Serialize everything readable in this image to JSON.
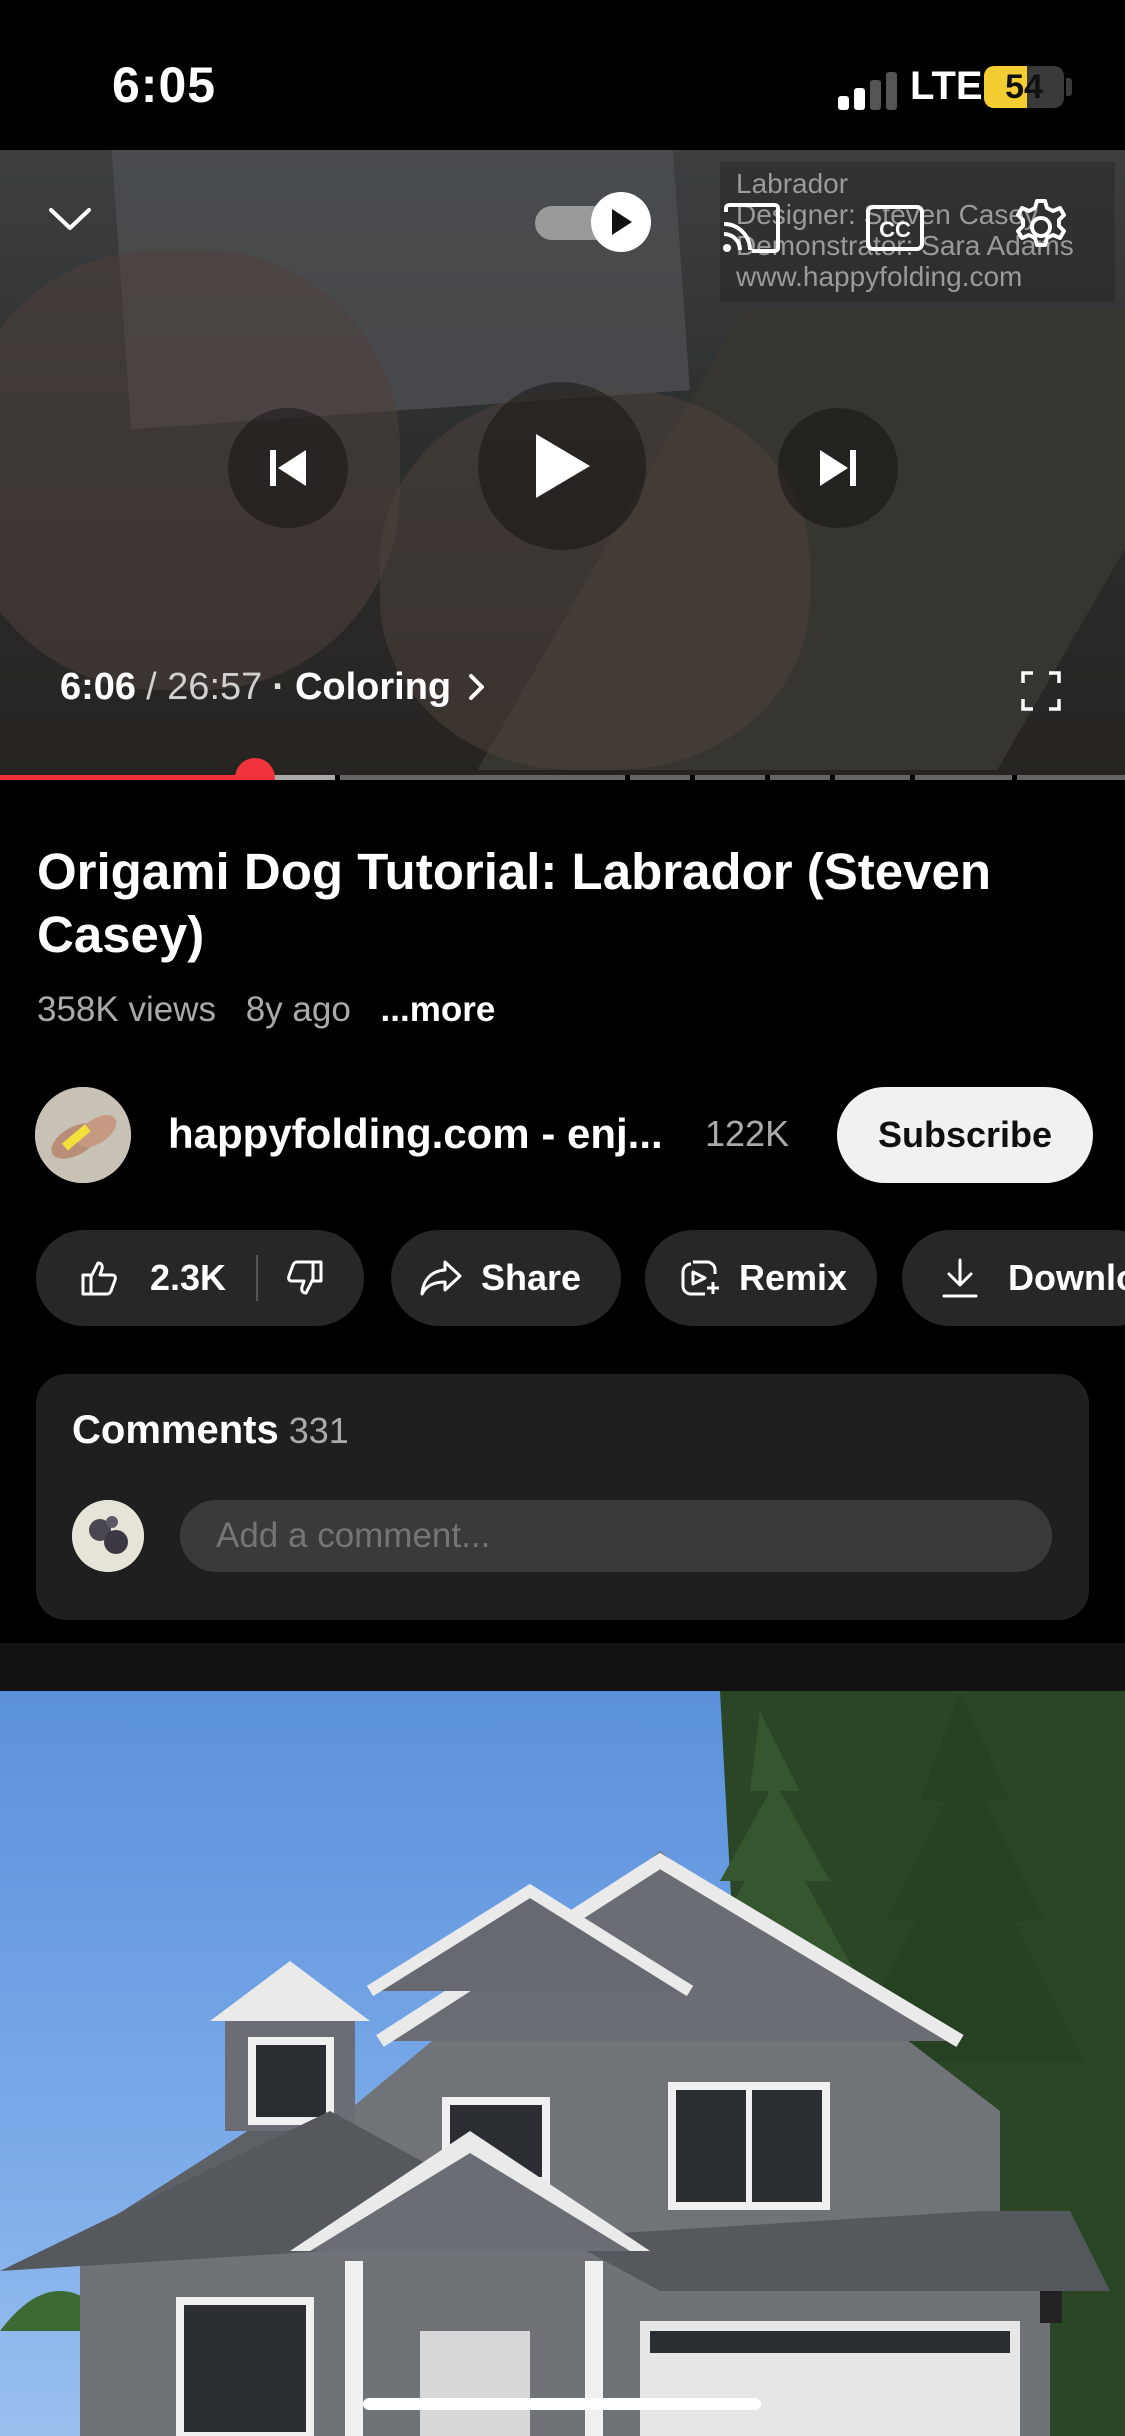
{
  "status_bar": {
    "time": "6:05",
    "network": "LTE",
    "battery": "54",
    "battery_level": 0.54
  },
  "player": {
    "watermark": [
      "Labrador",
      "Designer: Steven Casey",
      "Demonstrator: Sara Adams",
      "www.happyfolding.com"
    ],
    "current_time": "6:06",
    "total_time": "/ 26:57",
    "separator": "·",
    "chapter": "Coloring",
    "played_fraction": 0.227,
    "buffered_fraction": 0.3,
    "autoplay_on": true,
    "icons": {
      "collapse": "chevron-down-icon",
      "cast": "cast-icon",
      "captions": "closed-captions-icon",
      "settings": "gear-icon",
      "previous": "skip-previous-icon",
      "play": "play-icon",
      "next": "skip-next-icon",
      "fullscreen": "fullscreen-icon"
    }
  },
  "video": {
    "title": "Origami Dog Tutorial: Labrador (Steven Casey)",
    "views": "358K views",
    "age": "8y ago",
    "more": "...more"
  },
  "channel": {
    "name": "happyfolding.com - enj...",
    "subscribers": "122K",
    "subscribe_label": "Subscribe"
  },
  "actions": {
    "likes": "2.3K",
    "share": "Share",
    "remix": "Remix",
    "download": "Download"
  },
  "comments": {
    "title": "Comments",
    "count": "331",
    "placeholder": "Add a comment..."
  },
  "colors": {
    "accent_red": "#f0333a",
    "background": "#000000",
    "chip": "#272727",
    "card": "#1f1f1f",
    "battery": "#f4cd32"
  }
}
